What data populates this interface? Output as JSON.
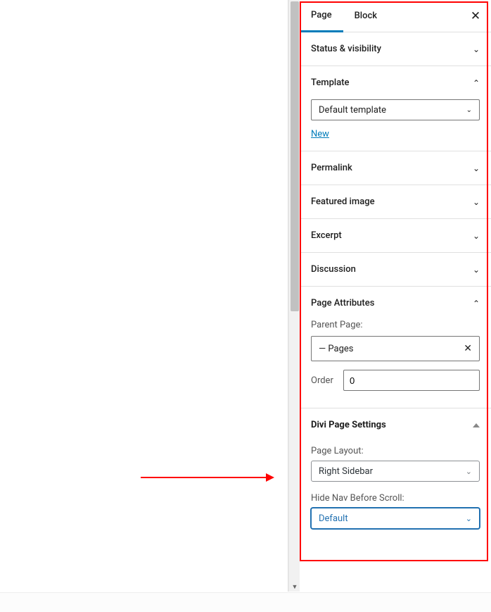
{
  "tabs": {
    "page": "Page",
    "block": "Block"
  },
  "sections": {
    "status": "Status & visibility",
    "template": {
      "title": "Template",
      "value": "Default template",
      "new_link": "New"
    },
    "permalink": "Permalink",
    "featured": "Featured image",
    "excerpt": "Excerpt",
    "discussion": "Discussion",
    "attributes": {
      "title": "Page Attributes",
      "parent_label": "Parent Page:",
      "parent_value": "— Pages",
      "order_label": "Order",
      "order_value": "0"
    }
  },
  "divi": {
    "title": "Divi Page Settings",
    "layout_label": "Page Layout:",
    "layout_value": "Right Sidebar",
    "hidenav_label": "Hide Nav Before Scroll:",
    "hidenav_value": "Default"
  }
}
